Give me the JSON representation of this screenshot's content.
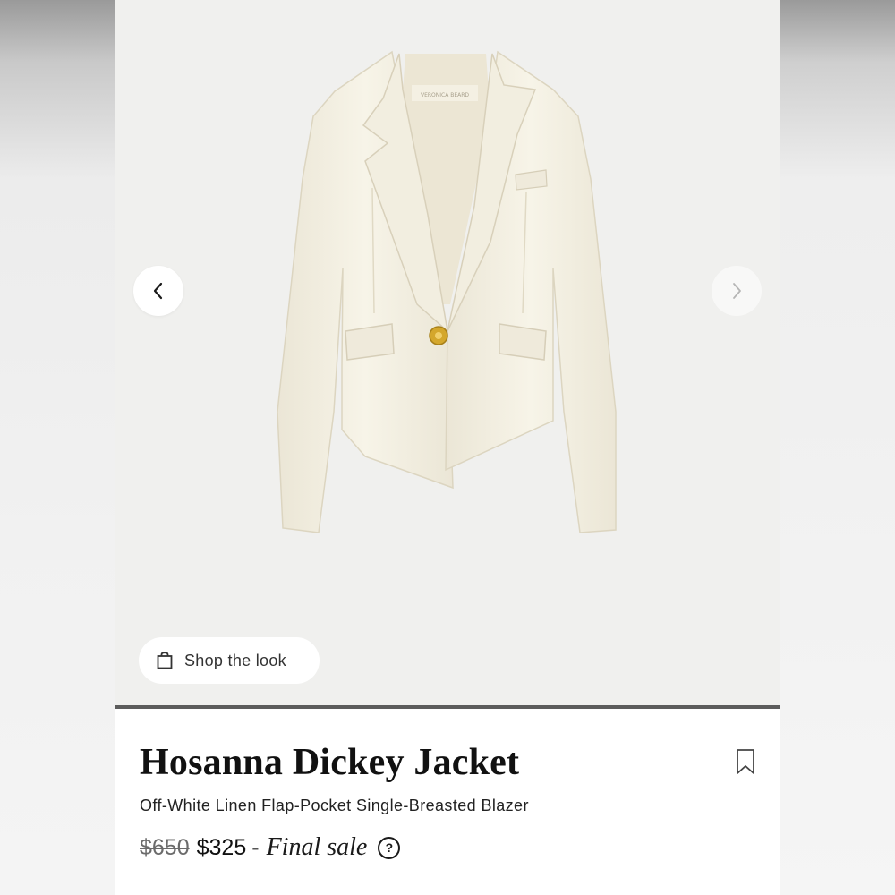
{
  "product": {
    "title": "Hosanna Dickey Jacket",
    "subtitle": "Off-White Linen Flap-Pocket Single-Breasted Blazer",
    "original_price": "$650",
    "sale_price": "$325",
    "price_separator": "-",
    "sale_note": "Final sale",
    "help_symbol": "?"
  },
  "gallery": {
    "shop_look_label": "Shop the look",
    "shop_look_icon": "shopping-bag-icon",
    "prev_icon": "chevron-left-icon",
    "next_icon": "chevron-right-icon",
    "image_label": "VERONICA BEARD"
  },
  "actions": {
    "bookmark_icon": "bookmark-icon"
  },
  "colors": {
    "gallery_bg": "#f0f0ee",
    "jacket": "#f5f1e3",
    "button_gold": "#d4a72c"
  }
}
